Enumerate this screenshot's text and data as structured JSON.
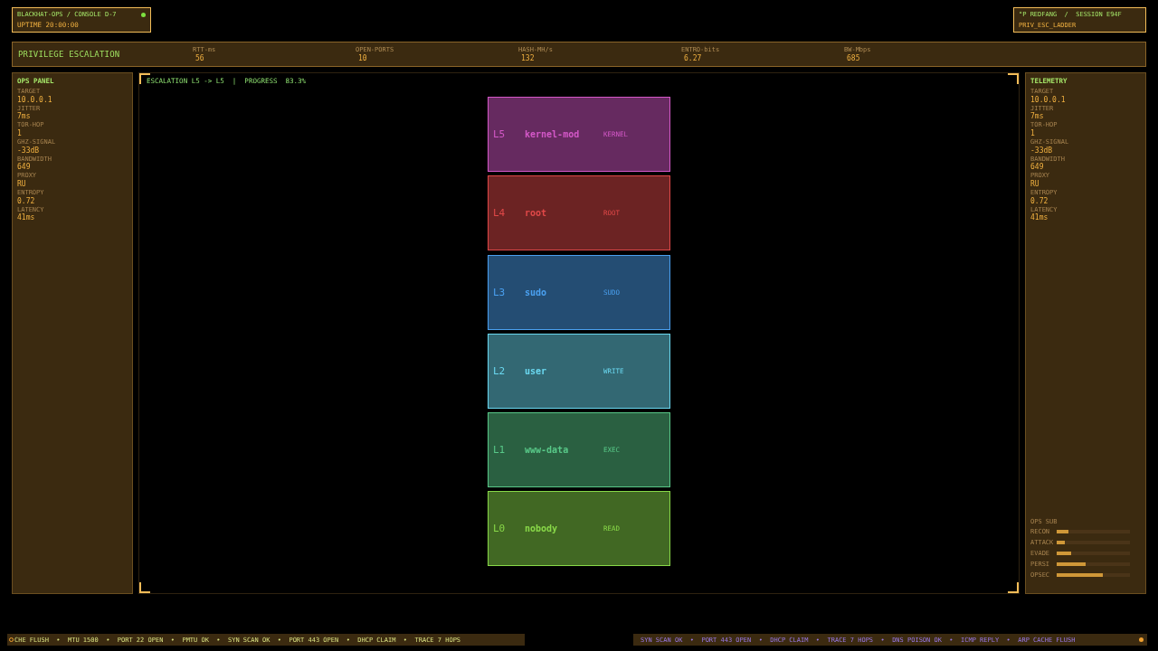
{
  "console_badge": {
    "title": "BLACKHAT-OPS / CONSOLE D-7",
    "uptime": "UPTIME 20:00:00"
  },
  "session_badge": {
    "title": "°P REDFANG  /  SESSION E94F",
    "module": "PRIV_ESC_LADDER"
  },
  "header": {
    "title": "PRIVILEGE ESCALATION",
    "stats": [
      {
        "label": "RTT-ms",
        "value": "56"
      },
      {
        "label": "OPEN-PORTS",
        "value": "10"
      },
      {
        "label": "HASH-MH/s",
        "value": "132"
      },
      {
        "label": "ENTRO-bits",
        "value": "6.27"
      },
      {
        "label": "BW-Mbps",
        "value": "685"
      }
    ]
  },
  "ops_panel": {
    "title": "OPS PANEL",
    "fields": [
      {
        "label": "TARGET",
        "value": "10.0.0.1"
      },
      {
        "label": "JITTER",
        "value": "7ms"
      },
      {
        "label": "TOR-HOP",
        "value": "1"
      },
      {
        "label": "GHZ-SIGNAL",
        "value": "-33dB"
      },
      {
        "label": "BANDWIDTH",
        "value": "649"
      },
      {
        "label": "PROXY",
        "value": "RU"
      },
      {
        "label": "ENTROPY",
        "value": "0.72"
      },
      {
        "label": "LATENCY",
        "value": "41ms"
      }
    ]
  },
  "stage": {
    "title": "ESCALATION L5 -> L5  |  PROGRESS  83.3%",
    "levels": [
      {
        "level": "L5",
        "name": "kernel-mod",
        "tag": "KERNEL",
        "color": "#d458c8"
      },
      {
        "level": "L4",
        "name": "root",
        "tag": "ROOT",
        "color": "#e04848"
      },
      {
        "level": "L3",
        "name": "sudo",
        "tag": "SUDO",
        "color": "#4aa0f0"
      },
      {
        "level": "L2",
        "name": "user",
        "tag": "WRITE",
        "color": "#6ad8f0"
      },
      {
        "level": "L1",
        "name": "www-data",
        "tag": "EXEC",
        "color": "#58c888"
      },
      {
        "level": "L0",
        "name": "nobody",
        "tag": "READ",
        "color": "#88d848"
      }
    ]
  },
  "telemetry": {
    "title": "TELEMETRY",
    "fields": [
      {
        "label": "TARGET",
        "value": "10.0.0.1"
      },
      {
        "label": "JITTER",
        "value": "7ms"
      },
      {
        "label": "TOR-HOP",
        "value": "1"
      },
      {
        "label": "GHZ-SIGNAL",
        "value": "-33dB"
      },
      {
        "label": "BANDWIDTH",
        "value": "649"
      },
      {
        "label": "PROXY",
        "value": "RU"
      },
      {
        "label": "ENTROPY",
        "value": "0.72"
      },
      {
        "label": "LATENCY",
        "value": "41ms"
      }
    ],
    "ops_sub": {
      "title": "OPS SUB",
      "bars": [
        {
          "label": "RECON",
          "level": 0.16
        },
        {
          "label": "ATTACK",
          "level": 0.11
        },
        {
          "label": "EVADE",
          "level": 0.2
        },
        {
          "label": "PERSI",
          "level": 0.39
        },
        {
          "label": "OPSEC",
          "level": 0.63
        }
      ]
    }
  },
  "ticker_left": {
    "text": "CHE FLUSH  •  MTU 1500  •  PORT 22 OPEN  •  PMTU OK  •  SYN SCAN OK  •  PORT 443 OPEN  •  DHCP CLAIM  •  TRACE 7 HOPS"
  },
  "ticker_right": {
    "text": "SYN SCAN OK  •  PORT 443 OPEN  •  DHCP CLAIM  •  TRACE 7 HOPS  •  DNS POISON OK  •  ICMP REPLY  •  ARP CACHE FLUSH"
  }
}
